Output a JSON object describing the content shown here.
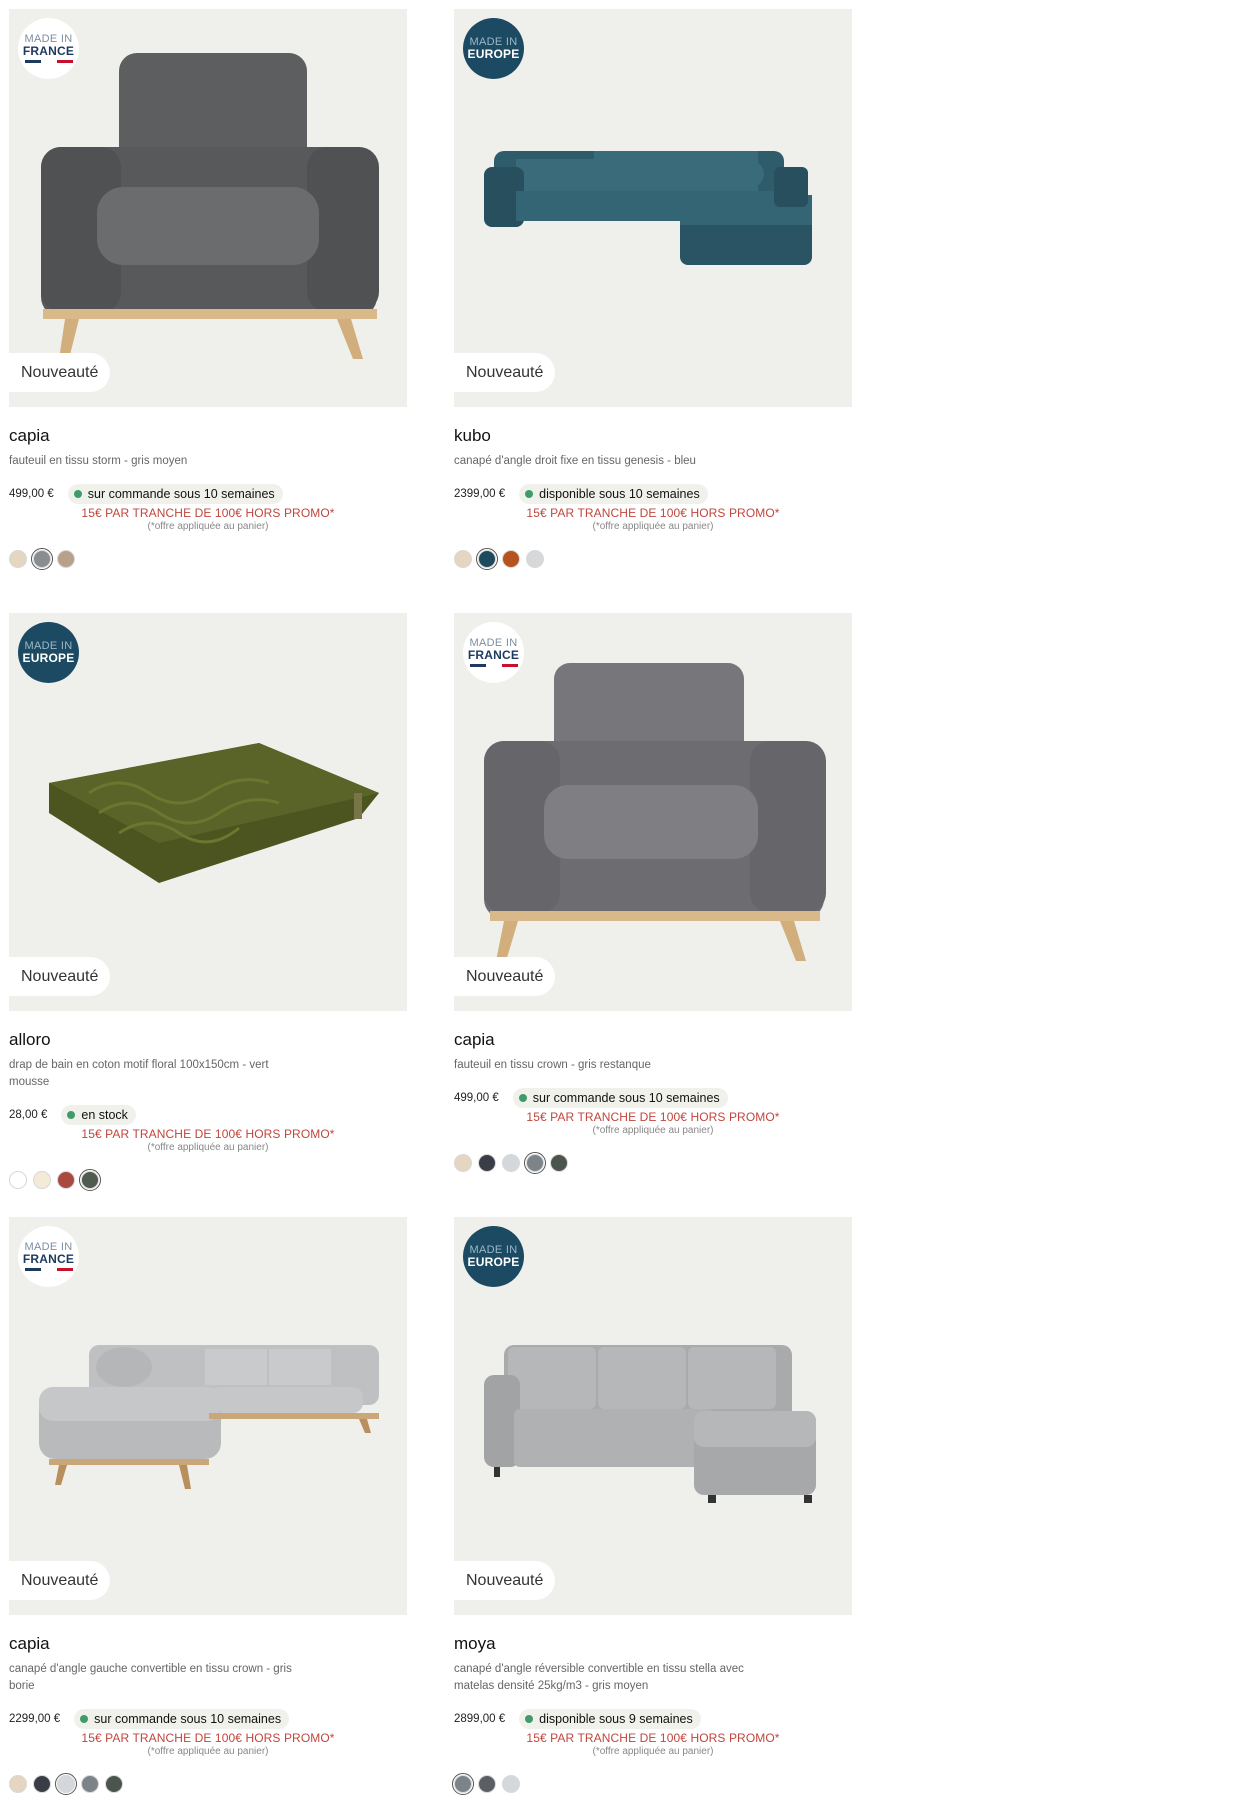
{
  "promo_text": "15€ PAR TRANCHE DE 100€ HORS PROMO*",
  "promo_note": "(*offre appliquée au panier)",
  "badge_new": "Nouveauté",
  "made_in_label": "MADE IN",
  "made_france": "FRANCE",
  "made_europe": "EUROPE",
  "products": [
    {
      "name": "capia",
      "desc": "fauteuil en tissu storm - gris moyen",
      "price": "499,00 €",
      "availability": "sur commande sous 10 semaines",
      "made_in": "france",
      "image": "armchair-dark-grey",
      "swatches": [
        "#e4d6c0",
        "#8a8d90",
        "#b8a18a"
      ],
      "selected": 1
    },
    {
      "name": "kubo",
      "desc": "canapé d'angle droit fixe en tissu genesis - bleu",
      "price": "2399,00 €",
      "availability": "disponible sous 10 semaines",
      "made_in": "europe",
      "image": "corner-sofa-teal",
      "swatches": [
        "#e4d6c0",
        "#1e4a5e",
        "#b5521d",
        "#d6d8da"
      ],
      "selected": 1
    },
    {
      "name": "alloro",
      "desc": "drap de bain en coton motif floral 100x150cm - vert mousse",
      "price": "28,00 €",
      "availability": "en stock",
      "made_in": "europe",
      "image": "green-towel",
      "swatches": [
        "#ffffff",
        "#f3ead8",
        "#a84a3f",
        "#4e5b4e"
      ],
      "selected": 3
    },
    {
      "name": "capia",
      "desc": "fauteuil en tissu crown - gris restanque",
      "price": "499,00 €",
      "availability": "sur commande sous 10 semaines",
      "made_in": "france",
      "image": "armchair-grey",
      "swatches": [
        "#e4d6c0",
        "#3a3d45",
        "#d4d8dc",
        "#7d8489",
        "#4b554d"
      ],
      "selected": 3
    },
    {
      "name": "capia",
      "desc": "canapé d'angle gauche convertible en tissu crown - gris borie",
      "price": "2299,00 €",
      "availability": "sur commande sous 10 semaines",
      "made_in": "france",
      "image": "corner-sofa-light-grey",
      "swatches": [
        "#e4d6c0",
        "#3a3d45",
        "#d4d8dc",
        "#7d8489",
        "#4b554d"
      ],
      "selected": 2
    },
    {
      "name": "moya",
      "desc": "canapé d'angle réversible convertible en tissu stella avec matelas densité 25kg/m3 - gris moyen",
      "price": "2899,00 €",
      "availability": "disponible sous 9 semaines",
      "made_in": "europe",
      "image": "corner-sofa-grey",
      "swatches": [
        "#7d8489",
        "#5b5e62",
        "#d4d8dc"
      ],
      "selected": 0
    }
  ]
}
